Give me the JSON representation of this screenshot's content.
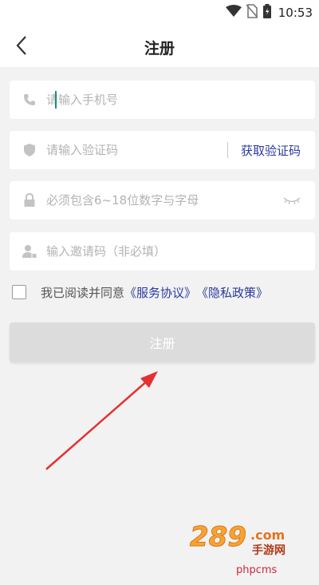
{
  "status_bar": {
    "time": "10:53"
  },
  "header": {
    "title": "注册"
  },
  "form": {
    "phone_placeholder": "请输入手机号",
    "code_placeholder": "请输入验证码",
    "get_code_label": "获取验证码",
    "password_placeholder": "必须包含6~18位数字与字母",
    "invite_placeholder": "输入邀请码（非必填）"
  },
  "agreement": {
    "prefix": "我已阅读并同意",
    "service_link": "《服务协议》",
    "privacy_link": "《隐私政策》"
  },
  "submit_label": "注册",
  "watermark": {
    "logo_text": "289.com",
    "sub_text": "手游网",
    "site_text": "phpcms"
  },
  "colors": {
    "link": "#2b3a9c",
    "annotation_arrow": "#e53030",
    "button_disabled": "#dcdcdc"
  }
}
